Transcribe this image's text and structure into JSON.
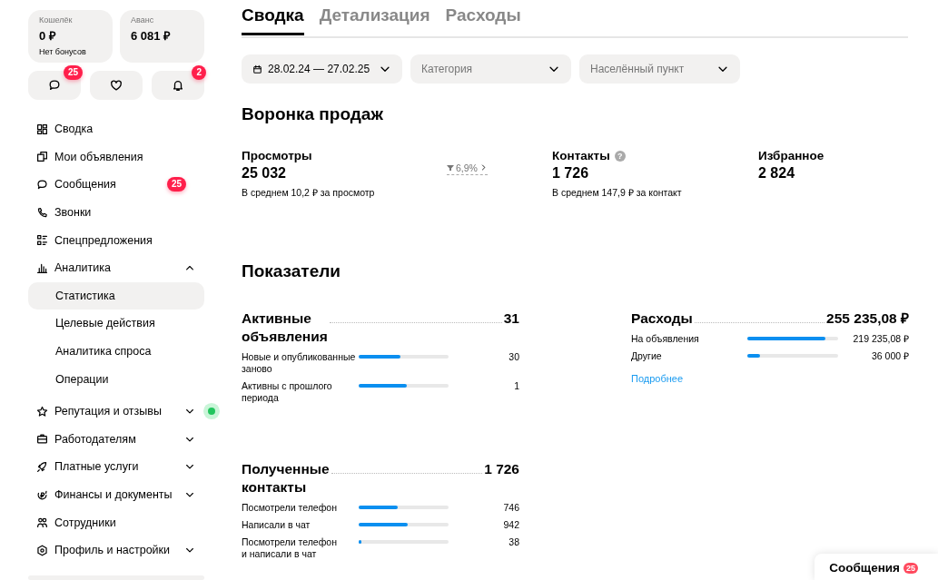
{
  "wallet_cards": [
    {
      "label": "Кошелёк",
      "amount": "0 ₽",
      "note": "Нет бонусов"
    },
    {
      "label": "Аванс",
      "amount": "6 081 ₽"
    }
  ],
  "quick_buttons": [
    {
      "kind": "messages",
      "badge": "25"
    },
    {
      "kind": "favorites"
    },
    {
      "kind": "notifications",
      "badge": "2"
    }
  ],
  "sidebar": {
    "items": [
      {
        "label": "Сводка"
      },
      {
        "label": "Мои объявления"
      },
      {
        "label": "Сообщения",
        "badge": "25"
      },
      {
        "label": "Звонки"
      },
      {
        "label": "Спецпредложения"
      },
      {
        "label": "Аналитика",
        "expanded": true,
        "children": [
          {
            "label": "Статистика",
            "selected": true
          },
          {
            "label": "Целевые действия",
            "selected": false
          },
          {
            "label": "Аналитика спроса",
            "selected": false
          },
          {
            "label": "Операции",
            "selected": false
          }
        ]
      },
      {
        "label": "Репутация и отзывы",
        "expanded": false,
        "color": "#22c55e"
      },
      {
        "label": "Работодателям",
        "expanded": false
      },
      {
        "label": "Платные услуги",
        "expanded": false
      },
      {
        "label": "Финансы и документы",
        "expanded": false
      },
      {
        "label": "Сотрудники"
      },
      {
        "label": "Профиль и настройки",
        "expanded": false
      }
    ]
  },
  "tabs": [
    {
      "label": "Сводка",
      "selected": true
    },
    {
      "label": "Детализация",
      "selected": false
    },
    {
      "label": "Расходы",
      "selected": false
    }
  ],
  "filters": [
    {
      "kind": "date",
      "value": "28.02.24 — 27.02.25"
    },
    {
      "kind": "select",
      "placeholder": "Категория"
    },
    {
      "kind": "select",
      "placeholder": "Населённый пункт"
    }
  ],
  "funnel": {
    "title": "Воронка продаж",
    "metrics": [
      {
        "label": "Просмотры",
        "value": "25 032",
        "note": "В среднем 10,2 ₽ за просмотр",
        "conversion": "6,9%"
      },
      {
        "label": "Контакты",
        "value": "1 726",
        "note": "В среднем 147,9 ₽ за контакт",
        "help": "?"
      },
      {
        "label": "Избранное",
        "value": "2 824"
      }
    ]
  },
  "indicators": {
    "title": "Показатели",
    "blocks": [
      {
        "title": "Активные объявления",
        "total": "31",
        "rows": [
          {
            "label": "Новые и опубликованные заново",
            "level": 0.46,
            "value": "30"
          },
          {
            "label": "Активны с прошлого периода",
            "level": 0.54,
            "value": "1"
          }
        ]
      },
      {
        "title": "Расходы",
        "total": "255 235,08 ₽",
        "rows": [
          {
            "label": "На объявления",
            "level": 0.86,
            "value": "219 235,08 ₽"
          },
          {
            "label": "Другие",
            "level": 0.14,
            "value": "36 000 ₽"
          }
        ],
        "link": "Подробнее"
      },
      {
        "title": "Полученные контакты",
        "total": "1 726",
        "rows": [
          {
            "label": "Посмотрели телефон",
            "level": 0.43,
            "value": "746"
          },
          {
            "label": "Написали в чат",
            "level": 0.55,
            "value": "942"
          },
          {
            "label": "Посмотрели телефон и написали в чат",
            "level": 0.03,
            "value": "38"
          }
        ]
      }
    ]
  },
  "messages_widget": {
    "label": "Сообщения",
    "badge": "25"
  }
}
